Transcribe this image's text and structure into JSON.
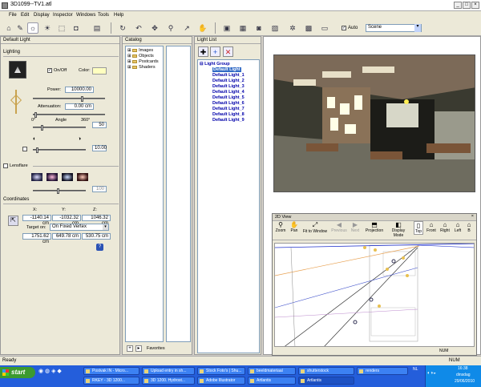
{
  "window": {
    "title": "3D1099--TV1.atl"
  },
  "menu": [
    "File",
    "Edit",
    "Display",
    "Inspector",
    "Windows",
    "Tools",
    "Help"
  ],
  "toolbar": {
    "auto_label": "Auto",
    "scene_value": "Scene"
  },
  "inspector": {
    "header": "Default Light",
    "section_lighting": "Lighting",
    "onoff_label": "On/Off",
    "color_label": "Color:",
    "power_label": "Power:",
    "power_value": "10000.00",
    "attenuation_label": "Attenuation:",
    "attenuation_value": "0.00 cm",
    "angle_min": "0°",
    "angle_label": "Angle",
    "angle_max": "360°",
    "angle_value": "50",
    "softness_value": "10.00",
    "lensflare_label": "Lensflare",
    "lensflare_value": "100",
    "coordinates_label": "Coordinates",
    "x_label": "X:",
    "y_label": "Y:",
    "z_label": "Z:",
    "x_value": "-1140.14 cm",
    "y_value": "-1032.32 cm",
    "z_value": "1046.32 cm",
    "target_label": "Target on:",
    "target_value": "On Fixed Vertex",
    "tx_value": "1751.62 cm",
    "ty_value": "649.78 cm",
    "tz_value": "530.75 cm",
    "help": "?"
  },
  "catalog": {
    "header": "Catalog",
    "items": [
      "Images",
      "Objects",
      "Postcards",
      "Shaders"
    ],
    "favorites_label": "Favorites"
  },
  "lightlist": {
    "header": "Light List",
    "group": "Light Group",
    "items": [
      "Default Light",
      "Default Light_1",
      "Default Light_2",
      "Default Light_3",
      "Default Light_4",
      "Default Light_5",
      "Default Light_6",
      "Default Light_7",
      "Default Light_8",
      "Default Light_9"
    ]
  },
  "view2d": {
    "title": "2D View",
    "tools": [
      "Zoom",
      "Pan",
      "Fit to Window",
      "Previous",
      "Next",
      "Projection",
      "Display Mode",
      "Top",
      "Front",
      "Right",
      "Left",
      "B"
    ],
    "status": "NUM"
  },
  "status": {
    "left": "Ready",
    "right": "NUM"
  },
  "taskbar": {
    "start": "start",
    "tasks_row1": [
      "Postvak IN - Micro...",
      "Upload entry in sh...",
      "Stock Foto's | Shu...",
      "beeldmateriaal",
      "shutterstock",
      "renders"
    ],
    "tasks_row2": [
      "RKEY - 3D 1200...",
      "3D 1200. Hydrost...",
      "Adobe Illustrator",
      "Artlantis",
      "Artlantis"
    ],
    "clock": "16:38",
    "day": "dinsdag",
    "date": "29/06/2010",
    "lang": "NL"
  },
  "colors": {
    "taskbar": "#245edb",
    "start": "#3c9a2f",
    "light_link": "#0000aa"
  }
}
